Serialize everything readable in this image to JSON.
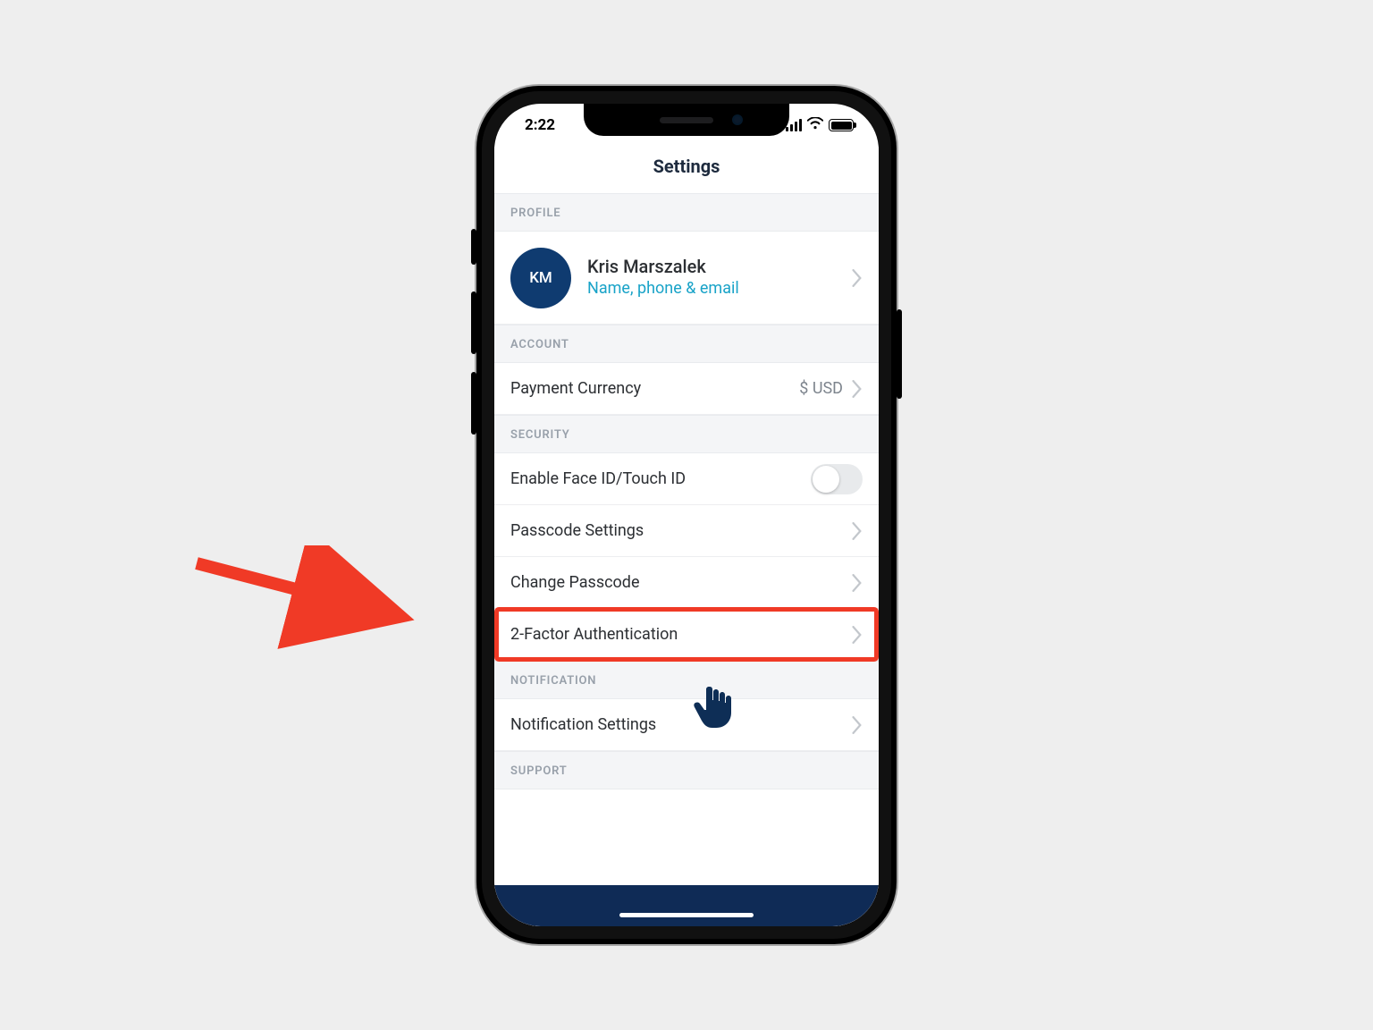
{
  "status": {
    "time": "2:22"
  },
  "header": {
    "title": "Settings"
  },
  "colors": {
    "avatar_bg": "#0f3b70",
    "link": "#19a3c8",
    "bottom_bar": "#0f2b56",
    "highlight": "#f03a26"
  },
  "sections": {
    "profile": {
      "header": "PROFILE",
      "avatar_initials": "KM",
      "name": "Kris Marszalek",
      "subtitle": "Name, phone & email"
    },
    "account": {
      "header": "ACCOUNT",
      "payment_currency_label": "Payment Currency",
      "payment_currency_value": "$ USD"
    },
    "security": {
      "header": "SECURITY",
      "face_touch_id_label": "Enable Face ID/Touch ID",
      "face_touch_id_enabled": false,
      "passcode_settings_label": "Passcode Settings",
      "change_passcode_label": "Change Passcode",
      "two_factor_label": "2-Factor Authentication"
    },
    "notification": {
      "header": "NOTIFICATION",
      "settings_label": "Notification Settings"
    },
    "support": {
      "header": "SUPPORT"
    }
  },
  "annotations": {
    "arrow": "arrow-pointing-to-2fa",
    "hand": "hand-cursor"
  }
}
